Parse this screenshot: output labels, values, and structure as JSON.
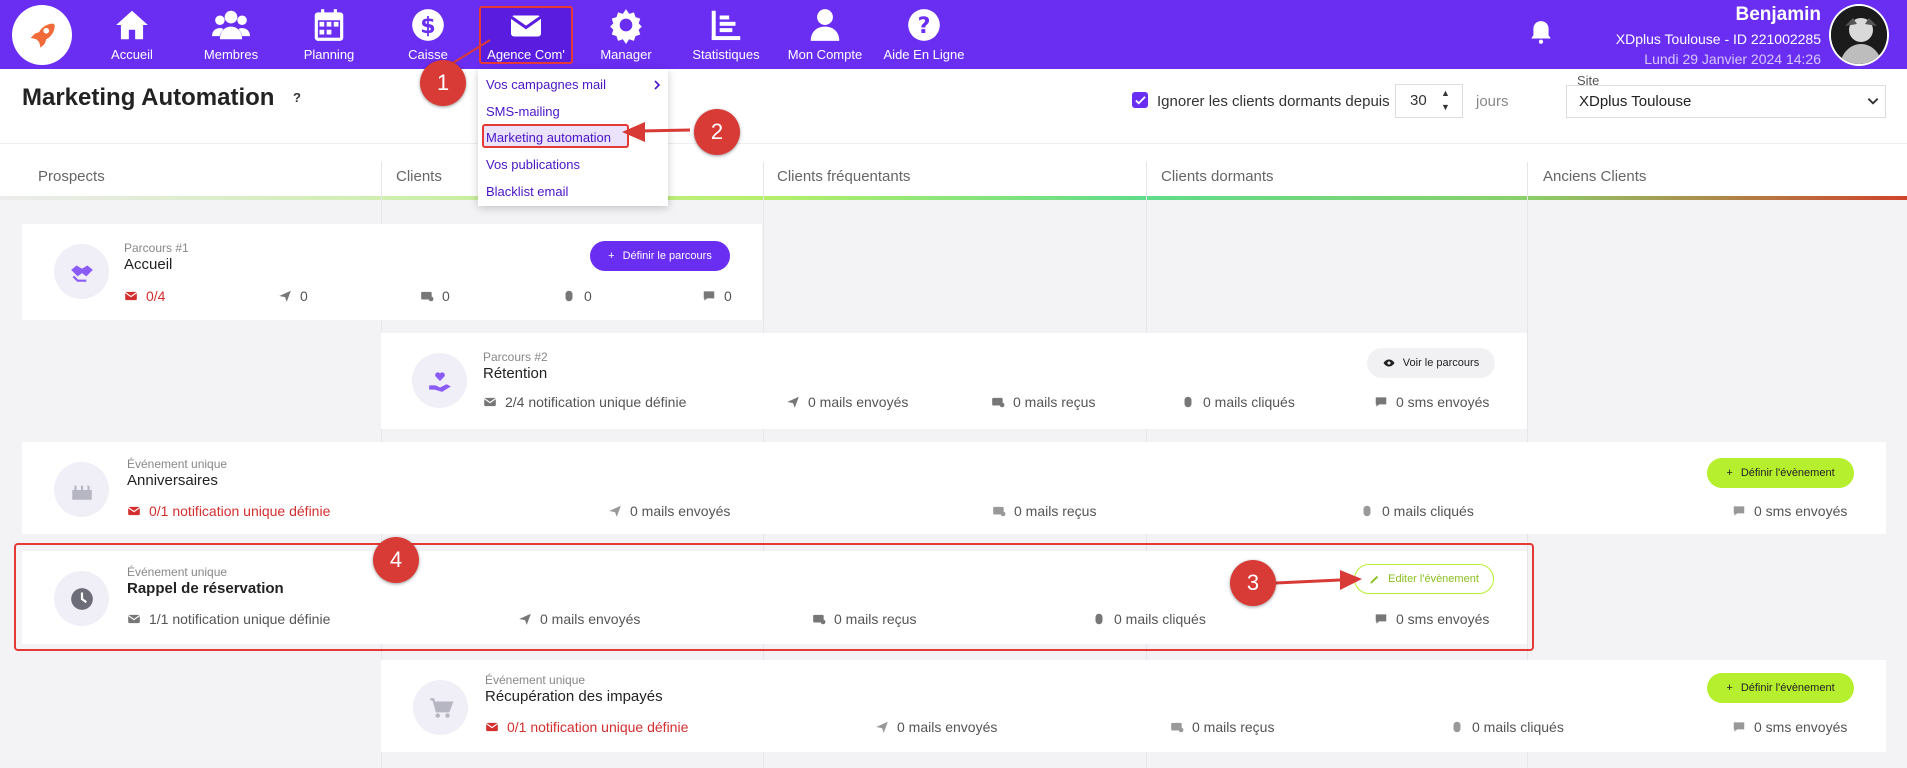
{
  "nav": {
    "items": [
      {
        "label": "Accueil",
        "icon": "home-icon"
      },
      {
        "label": "Membres",
        "icon": "users-icon"
      },
      {
        "label": "Planning",
        "icon": "calendar-icon"
      },
      {
        "label": "Caisse",
        "icon": "dollar-icon"
      },
      {
        "label": "Agence Com'",
        "icon": "envelope-icon"
      },
      {
        "label": "Manager",
        "icon": "gear-icon"
      },
      {
        "label": "Statistiques",
        "icon": "chart-icon"
      },
      {
        "label": "Mon Compte",
        "icon": "user-icon"
      },
      {
        "label": "Aide En Ligne",
        "icon": "question-icon"
      }
    ]
  },
  "user": {
    "name": "Benjamin",
    "site": "XDplus Toulouse - ID 221002285",
    "date": "Lundi 29 Janvier 2024 14:26"
  },
  "dropdown": {
    "items": [
      "Vos campagnes mail",
      "SMS-mailing",
      "Marketing automation",
      "Vos publications",
      "Blacklist email"
    ]
  },
  "page": {
    "title": "Marketing Automation",
    "help": "?",
    "ignore_label": "Ignorer les clients dormants depuis",
    "ignore_days": "30",
    "days_suffix": "jours",
    "site_label": "Site",
    "site_value": "XDplus Toulouse"
  },
  "columns": [
    "Prospects",
    "Clients",
    "Clients fréquentants",
    "Clients dormants",
    "Anciens Clients"
  ],
  "colors": {
    "accent": "#6a2df2",
    "lime": "#b6ef2d",
    "alert": "#d32f2f",
    "annotation": "#d83a35"
  },
  "cards": {
    "c1": {
      "kicker": "Parcours #1",
      "name": "Accueil",
      "button": "Définir le parcours",
      "s1": "0/4",
      "s2": "0",
      "s3": "0",
      "s4": "0",
      "s5": "0"
    },
    "c2": {
      "kicker": "Parcours #2",
      "name": "Rétention",
      "button": "Voir le parcours",
      "s1": "2/4  notification unique définie",
      "s2": "0  mails envoyés",
      "s3": "0  mails reçus",
      "s4": "0  mails cliqués",
      "s5": "0  sms envoyés"
    },
    "c3": {
      "kicker": "Événement unique",
      "name": "Anniversaires",
      "button": "Définir l'évènement",
      "s1": "0/1  notification unique définie",
      "s2": "0  mails envoyés",
      "s3": "0  mails reçus",
      "s4": "0  mails cliqués",
      "s5": "0  sms envoyés"
    },
    "c4": {
      "kicker": "Événement unique",
      "name": "Rappel de réservation",
      "button": "Editer l'évènement",
      "s1": "1/1  notification unique définie",
      "s2": "0  mails envoyés",
      "s3": "0  mails reçus",
      "s4": "0  mails cliqués",
      "s5": "0  sms envoyés"
    },
    "c5": {
      "kicker": "Événement unique",
      "name": "Récupération des impayés",
      "button": "Définir l'évènement",
      "s1": "0/1  notification unique définie",
      "s2": "0  mails envoyés",
      "s3": "0  mails reçus",
      "s4": "0  mails cliqués",
      "s5": "0  sms envoyés"
    }
  },
  "markers": [
    "1",
    "2",
    "3",
    "4"
  ]
}
